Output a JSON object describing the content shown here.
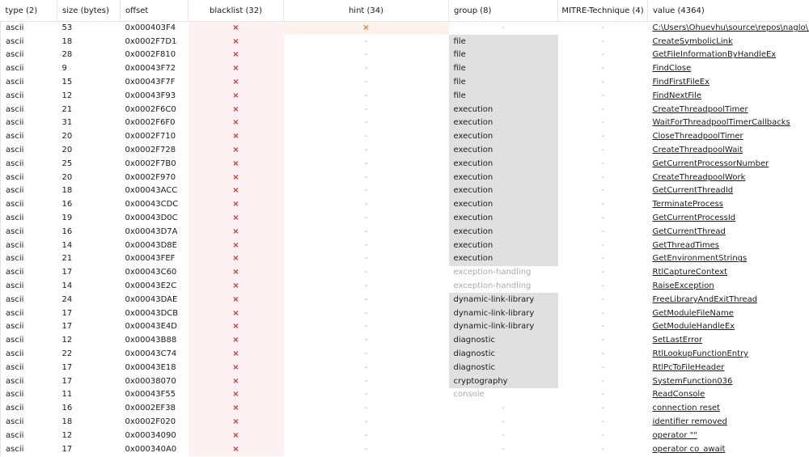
{
  "headers": {
    "type": "type (2)",
    "size": "size (bytes)",
    "offset": "offset",
    "blacklist": "blacklist (32)",
    "hint": "hint (34)",
    "group": "group (8)",
    "mitre": "MITRE-Technique (4)",
    "value": "value (4364)"
  },
  "symbols": {
    "cross": "×",
    "dash": "-"
  },
  "colors": {
    "blacklist_bg": "#fdf1f4",
    "blacklist_mark": "#d9302c",
    "hint_mark": "#e27a2f",
    "group_bg": "#e0e0e0"
  },
  "rows": [
    {
      "type": "ascii",
      "size": "53",
      "offset": "0x000403F4",
      "blacklist": "×",
      "hint": "×",
      "group": "-",
      "group_style": "dash",
      "mitre": "-",
      "value": "C:\\Users\\Ohuevhu\\source\\repos\\naglo\\Release\\naglo.pdb"
    },
    {
      "type": "ascii",
      "size": "18",
      "offset": "0x0002F7D1",
      "blacklist": "×",
      "hint": "-",
      "group": "file",
      "group_style": "filled",
      "mitre": "-",
      "value": "CreateSymbolicLink"
    },
    {
      "type": "ascii",
      "size": "28",
      "offset": "0x0002F810",
      "blacklist": "×",
      "hint": "-",
      "group": "file",
      "group_style": "filled",
      "mitre": "-",
      "value": "GetFileInformationByHandleEx"
    },
    {
      "type": "ascii",
      "size": "9",
      "offset": "0x00043F72",
      "blacklist": "×",
      "hint": "-",
      "group": "file",
      "group_style": "filled",
      "mitre": "-",
      "value": "FindClose"
    },
    {
      "type": "ascii",
      "size": "15",
      "offset": "0x00043F7F",
      "blacklist": "×",
      "hint": "-",
      "group": "file",
      "group_style": "filled",
      "mitre": "-",
      "value": "FindFirstFileEx"
    },
    {
      "type": "ascii",
      "size": "12",
      "offset": "0x00043F93",
      "blacklist": "×",
      "hint": "-",
      "group": "file",
      "group_style": "filled",
      "mitre": "-",
      "value": "FindNextFile"
    },
    {
      "type": "ascii",
      "size": "21",
      "offset": "0x0002F6C0",
      "blacklist": "×",
      "hint": "-",
      "group": "execution",
      "group_style": "filled",
      "mitre": "-",
      "value": "CreateThreadpoolTimer"
    },
    {
      "type": "ascii",
      "size": "31",
      "offset": "0x0002F6F0",
      "blacklist": "×",
      "hint": "-",
      "group": "execution",
      "group_style": "filled",
      "mitre": "-",
      "value": "WaitForThreadpoolTimerCallbacks"
    },
    {
      "type": "ascii",
      "size": "20",
      "offset": "0x0002F710",
      "blacklist": "×",
      "hint": "-",
      "group": "execution",
      "group_style": "filled",
      "mitre": "-",
      "value": "CloseThreadpoolTimer"
    },
    {
      "type": "ascii",
      "size": "20",
      "offset": "0x0002F728",
      "blacklist": "×",
      "hint": "-",
      "group": "execution",
      "group_style": "filled",
      "mitre": "-",
      "value": "CreateThreadpoolWait"
    },
    {
      "type": "ascii",
      "size": "25",
      "offset": "0x0002F7B0",
      "blacklist": "×",
      "hint": "-",
      "group": "execution",
      "group_style": "filled",
      "mitre": "-",
      "value": "GetCurrentProcessorNumber"
    },
    {
      "type": "ascii",
      "size": "20",
      "offset": "0x0002F970",
      "blacklist": "×",
      "hint": "-",
      "group": "execution",
      "group_style": "filled",
      "mitre": "-",
      "value": "CreateThreadpoolWork"
    },
    {
      "type": "ascii",
      "size": "18",
      "offset": "0x00043ACC",
      "blacklist": "×",
      "hint": "-",
      "group": "execution",
      "group_style": "filled",
      "mitre": "-",
      "value": "GetCurrentThreadId"
    },
    {
      "type": "ascii",
      "size": "16",
      "offset": "0x00043CDC",
      "blacklist": "×",
      "hint": "-",
      "group": "execution",
      "group_style": "filled",
      "mitre": "-",
      "value": "TerminateProcess"
    },
    {
      "type": "ascii",
      "size": "19",
      "offset": "0x00043D0C",
      "blacklist": "×",
      "hint": "-",
      "group": "execution",
      "group_style": "filled",
      "mitre": "-",
      "value": "GetCurrentProcessId"
    },
    {
      "type": "ascii",
      "size": "16",
      "offset": "0x00043D7A",
      "blacklist": "×",
      "hint": "-",
      "group": "execution",
      "group_style": "filled",
      "mitre": "-",
      "value": "GetCurrentThread"
    },
    {
      "type": "ascii",
      "size": "14",
      "offset": "0x00043D8E",
      "blacklist": "×",
      "hint": "-",
      "group": "execution",
      "group_style": "filled",
      "mitre": "-",
      "value": "GetThreadTimes"
    },
    {
      "type": "ascii",
      "size": "21",
      "offset": "0x00043FEF",
      "blacklist": "×",
      "hint": "-",
      "group": "execution",
      "group_style": "filled",
      "mitre": "-",
      "value": "GetEnvironmentStrings"
    },
    {
      "type": "ascii",
      "size": "17",
      "offset": "0x00043C60",
      "blacklist": "×",
      "hint": "-",
      "group": "exception-handling",
      "group_style": "faded",
      "mitre": "-",
      "value": "RtlCaptureContext"
    },
    {
      "type": "ascii",
      "size": "14",
      "offset": "0x00043E2C",
      "blacklist": "×",
      "hint": "-",
      "group": "exception-handling",
      "group_style": "faded",
      "mitre": "-",
      "value": "RaiseException"
    },
    {
      "type": "ascii",
      "size": "24",
      "offset": "0x00043DAE",
      "blacklist": "×",
      "hint": "-",
      "group": "dynamic-link-library",
      "group_style": "filled",
      "mitre": "-",
      "value": "FreeLibraryAndExitThread"
    },
    {
      "type": "ascii",
      "size": "17",
      "offset": "0x00043DCB",
      "blacklist": "×",
      "hint": "-",
      "group": "dynamic-link-library",
      "group_style": "filled",
      "mitre": "-",
      "value": "GetModuleFileName"
    },
    {
      "type": "ascii",
      "size": "17",
      "offset": "0x00043E4D",
      "blacklist": "×",
      "hint": "-",
      "group": "dynamic-link-library",
      "group_style": "filled",
      "mitre": "-",
      "value": "GetModuleHandleEx"
    },
    {
      "type": "ascii",
      "size": "12",
      "offset": "0x00043B88",
      "blacklist": "×",
      "hint": "-",
      "group": "diagnostic",
      "group_style": "filled",
      "mitre": "-",
      "value": "SetLastError"
    },
    {
      "type": "ascii",
      "size": "22",
      "offset": "0x00043C74",
      "blacklist": "×",
      "hint": "-",
      "group": "diagnostic",
      "group_style": "filled",
      "mitre": "-",
      "value": "RtlLookupFunctionEntry"
    },
    {
      "type": "ascii",
      "size": "17",
      "offset": "0x00043E18",
      "blacklist": "×",
      "hint": "-",
      "group": "diagnostic",
      "group_style": "filled",
      "mitre": "-",
      "value": "RtlPcToFileHeader"
    },
    {
      "type": "ascii",
      "size": "17",
      "offset": "0x00038070",
      "blacklist": "×",
      "hint": "-",
      "group": "cryptography",
      "group_style": "filled",
      "mitre": "-",
      "value": "SystemFunction036"
    },
    {
      "type": "ascii",
      "size": "11",
      "offset": "0x00043F55",
      "blacklist": "×",
      "hint": "-",
      "group": "console",
      "group_style": "faded",
      "mitre": "-",
      "value": "ReadConsole"
    },
    {
      "type": "ascii",
      "size": "16",
      "offset": "0x0002EF38",
      "blacklist": "×",
      "hint": "-",
      "group": "-",
      "group_style": "dash",
      "mitre": "-",
      "value": "connection reset"
    },
    {
      "type": "ascii",
      "size": "18",
      "offset": "0x0002F020",
      "blacklist": "×",
      "hint": "-",
      "group": "-",
      "group_style": "dash",
      "mitre": "-",
      "value": "identifier removed"
    },
    {
      "type": "ascii",
      "size": "12",
      "offset": "0x00034090",
      "blacklist": "×",
      "hint": "-",
      "group": "-",
      "group_style": "dash",
      "mitre": "-",
      "value": "operator \"\" "
    },
    {
      "type": "ascii",
      "size": "17",
      "offset": "0x000340A0",
      "blacklist": "×",
      "hint": "-",
      "group": "-",
      "group_style": "dash",
      "mitre": "-",
      "value": "operator co_await"
    }
  ]
}
